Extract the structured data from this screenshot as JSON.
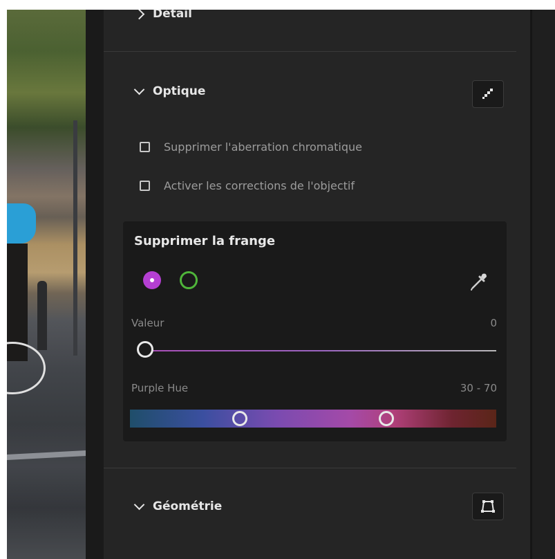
{
  "panel": {
    "detail_section": {
      "title": "Détail"
    },
    "optique_section": {
      "title": "Optique",
      "checkboxes": [
        {
          "label": "Supprimer l'aberration chromatique",
          "checked": false
        },
        {
          "label": "Activer les corrections de l'objectif",
          "checked": false
        }
      ]
    },
    "fringe": {
      "title": "Supprimer la frange",
      "selected_swatch": "purple",
      "colors": {
        "purple": "#b43fd2",
        "green": "#4fb53a"
      },
      "amount": {
        "label": "Valeur",
        "value": "0"
      },
      "purple_hue": {
        "label": "Purple Hue",
        "value": "30 - 70",
        "range": [
          30,
          70
        ]
      }
    },
    "geometrie_section": {
      "title": "Géométrie"
    }
  },
  "icons": {
    "optique_toggle": "before-after-icon",
    "eyedropper": "eyedropper-icon",
    "geometrie_toggle": "perspective-icon"
  }
}
